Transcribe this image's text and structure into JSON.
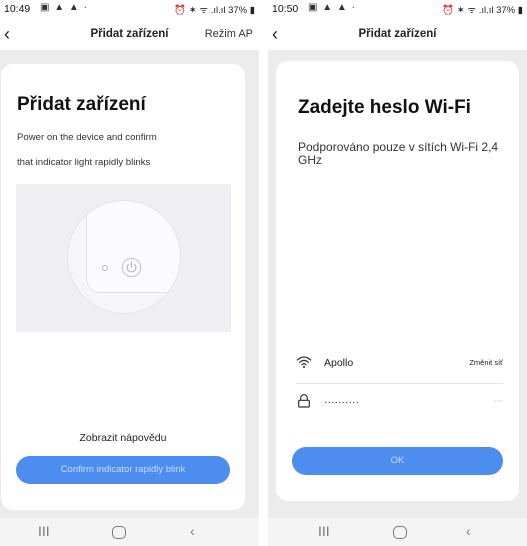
{
  "left": {
    "status": {
      "time": "10:49",
      "notif_icons": "▣ ▲ ▲ ·",
      "system_icons": "⏰ ✶ ᯤ .ıl.ıl 37% ▮"
    },
    "appbar": {
      "back": "‹",
      "title": "Přidat zařízení",
      "action": "Režim AP"
    },
    "card": {
      "title": "Přidat zařízení",
      "instruction_line1": "Power on the device and confirm",
      "instruction_line2": "that indicator light rapidly blinks",
      "help_link": "Zobrazit nápovědu",
      "confirm_button": "Confirm indicator rapidly blink"
    },
    "navbar": {
      "recents": "III",
      "back": "‹"
    }
  },
  "right": {
    "status": {
      "time": "10:50",
      "notif_icons": "▣ ▲ ▲ ·",
      "system_icons": "⏰ ✶ ᯤ .ıl.ıl 37% ▮"
    },
    "appbar": {
      "back": "‹",
      "title": "Přidat zařízení"
    },
    "card": {
      "title": "Zadejte heslo Wi-Fi",
      "subtitle": "Podporováno pouze v sítích Wi-Fi 2,4 GHz",
      "ssid": "Apollo",
      "change_network": "Změnit síť",
      "password_masked": "··········",
      "show_password": "⌣⌣",
      "ok_button": "OK"
    },
    "navbar": {
      "recents": "III",
      "back": "‹"
    }
  },
  "colors": {
    "accent": "#4d8df0",
    "screen_bg": "#ececec",
    "card_bg": "#ffffff"
  },
  "icons": [
    "back-arrow-icon",
    "power-icon",
    "led-indicator-icon",
    "wifi-icon",
    "lock-icon",
    "eye-icon"
  ]
}
